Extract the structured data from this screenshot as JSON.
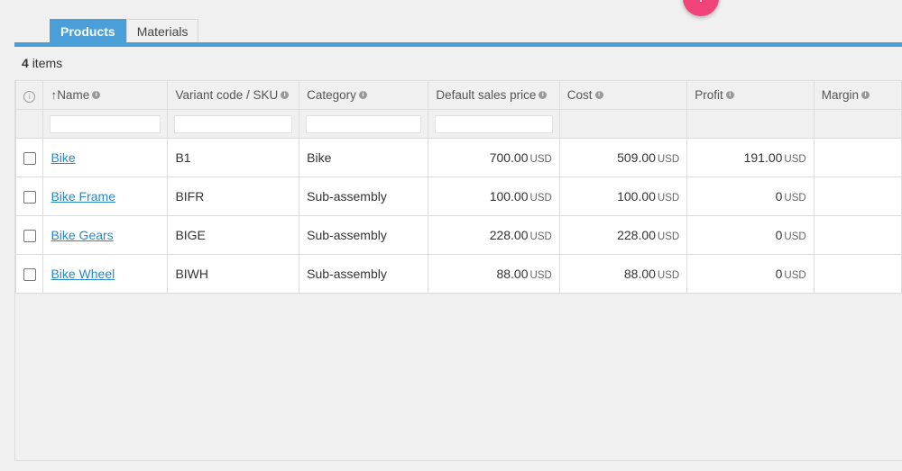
{
  "fab": {
    "label": "+"
  },
  "tabs": [
    {
      "label": "Products",
      "active": true
    },
    {
      "label": "Materials",
      "active": false
    }
  ],
  "summary": {
    "count": "4",
    "suffix": "items"
  },
  "columns": [
    {
      "key": "name",
      "label": "Name",
      "sort_icon": "arrow-up-icon"
    },
    {
      "key": "sku",
      "label": "Variant code / SKU"
    },
    {
      "key": "category",
      "label": "Category"
    },
    {
      "key": "price",
      "label": "Default sales price"
    },
    {
      "key": "cost",
      "label": "Cost"
    },
    {
      "key": "profit",
      "label": "Profit"
    },
    {
      "key": "margin",
      "label": "Margin"
    }
  ],
  "rows": [
    {
      "name": "Bike",
      "sku": "B1",
      "category": "Bike",
      "price": "700.00",
      "cost": "509.00",
      "profit": "191.00",
      "currency": "USD"
    },
    {
      "name": "Bike Frame",
      "sku": "BIFR",
      "category": "Sub-assembly",
      "price": "100.00",
      "cost": "100.00",
      "profit": "0",
      "currency": "USD"
    },
    {
      "name": "Bike Gears",
      "sku": "BIGE",
      "category": "Sub-assembly",
      "price": "228.00",
      "cost": "228.00",
      "profit": "0",
      "currency": "USD"
    },
    {
      "name": "Bike Wheel",
      "sku": "BIWH",
      "category": "Sub-assembly",
      "price": "88.00",
      "cost": "88.00",
      "profit": "0",
      "currency": "USD"
    }
  ],
  "colors": {
    "accent": "#4a9fd8",
    "fab": "#f0437a",
    "link": "#2a88c6"
  }
}
